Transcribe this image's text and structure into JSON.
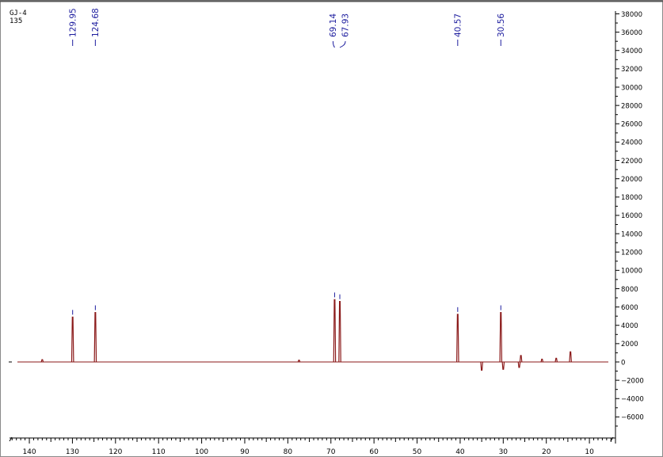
{
  "sample": {
    "name": "GJ-4",
    "experiment": "135"
  },
  "colors": {
    "spectrum": "#8b1a1a",
    "peak_label": "#1c1c9e",
    "axis": "#000000",
    "border": "#888888"
  },
  "chart_data": {
    "type": "line",
    "title": "",
    "xlabel": "",
    "ylabel": "",
    "xlim": [
      143.5,
      4.5
    ],
    "ylim": [
      -8300,
      38300
    ],
    "x_ticks": [
      140,
      130,
      120,
      110,
      100,
      90,
      80,
      70,
      60,
      50,
      40,
      30,
      20,
      10
    ],
    "y_ticks": [
      38000,
      36000,
      34000,
      32000,
      30000,
      28000,
      26000,
      24000,
      22000,
      20000,
      18000,
      16000,
      14000,
      12000,
      10000,
      8000,
      6000,
      4000,
      2000,
      0,
      -2000,
      -4000,
      -6000
    ],
    "peak_labels": [
      "129.95",
      "124.68",
      "69.14",
      "67.93",
      "40.57",
      "30.56"
    ],
    "series": [
      {
        "peaks": [
          {
            "x": 129.95,
            "y": 4900
          },
          {
            "x": 124.68,
            "y": 5400
          },
          {
            "x": 69.14,
            "y": 6800
          },
          {
            "x": 67.93,
            "y": 6600
          },
          {
            "x": 40.57,
            "y": 5200
          },
          {
            "x": 30.56,
            "y": 5400
          },
          {
            "x": 137.0,
            "y": 250
          },
          {
            "x": 77.4,
            "y": 200
          },
          {
            "x": 35.0,
            "y": -900
          },
          {
            "x": 30.0,
            "y": -800
          },
          {
            "x": 26.3,
            "y": -600
          },
          {
            "x": 25.9,
            "y": 700
          },
          {
            "x": 21.0,
            "y": 300
          },
          {
            "x": 17.7,
            "y": 400
          },
          {
            "x": 14.4,
            "y": 1100
          }
        ]
      }
    ]
  }
}
